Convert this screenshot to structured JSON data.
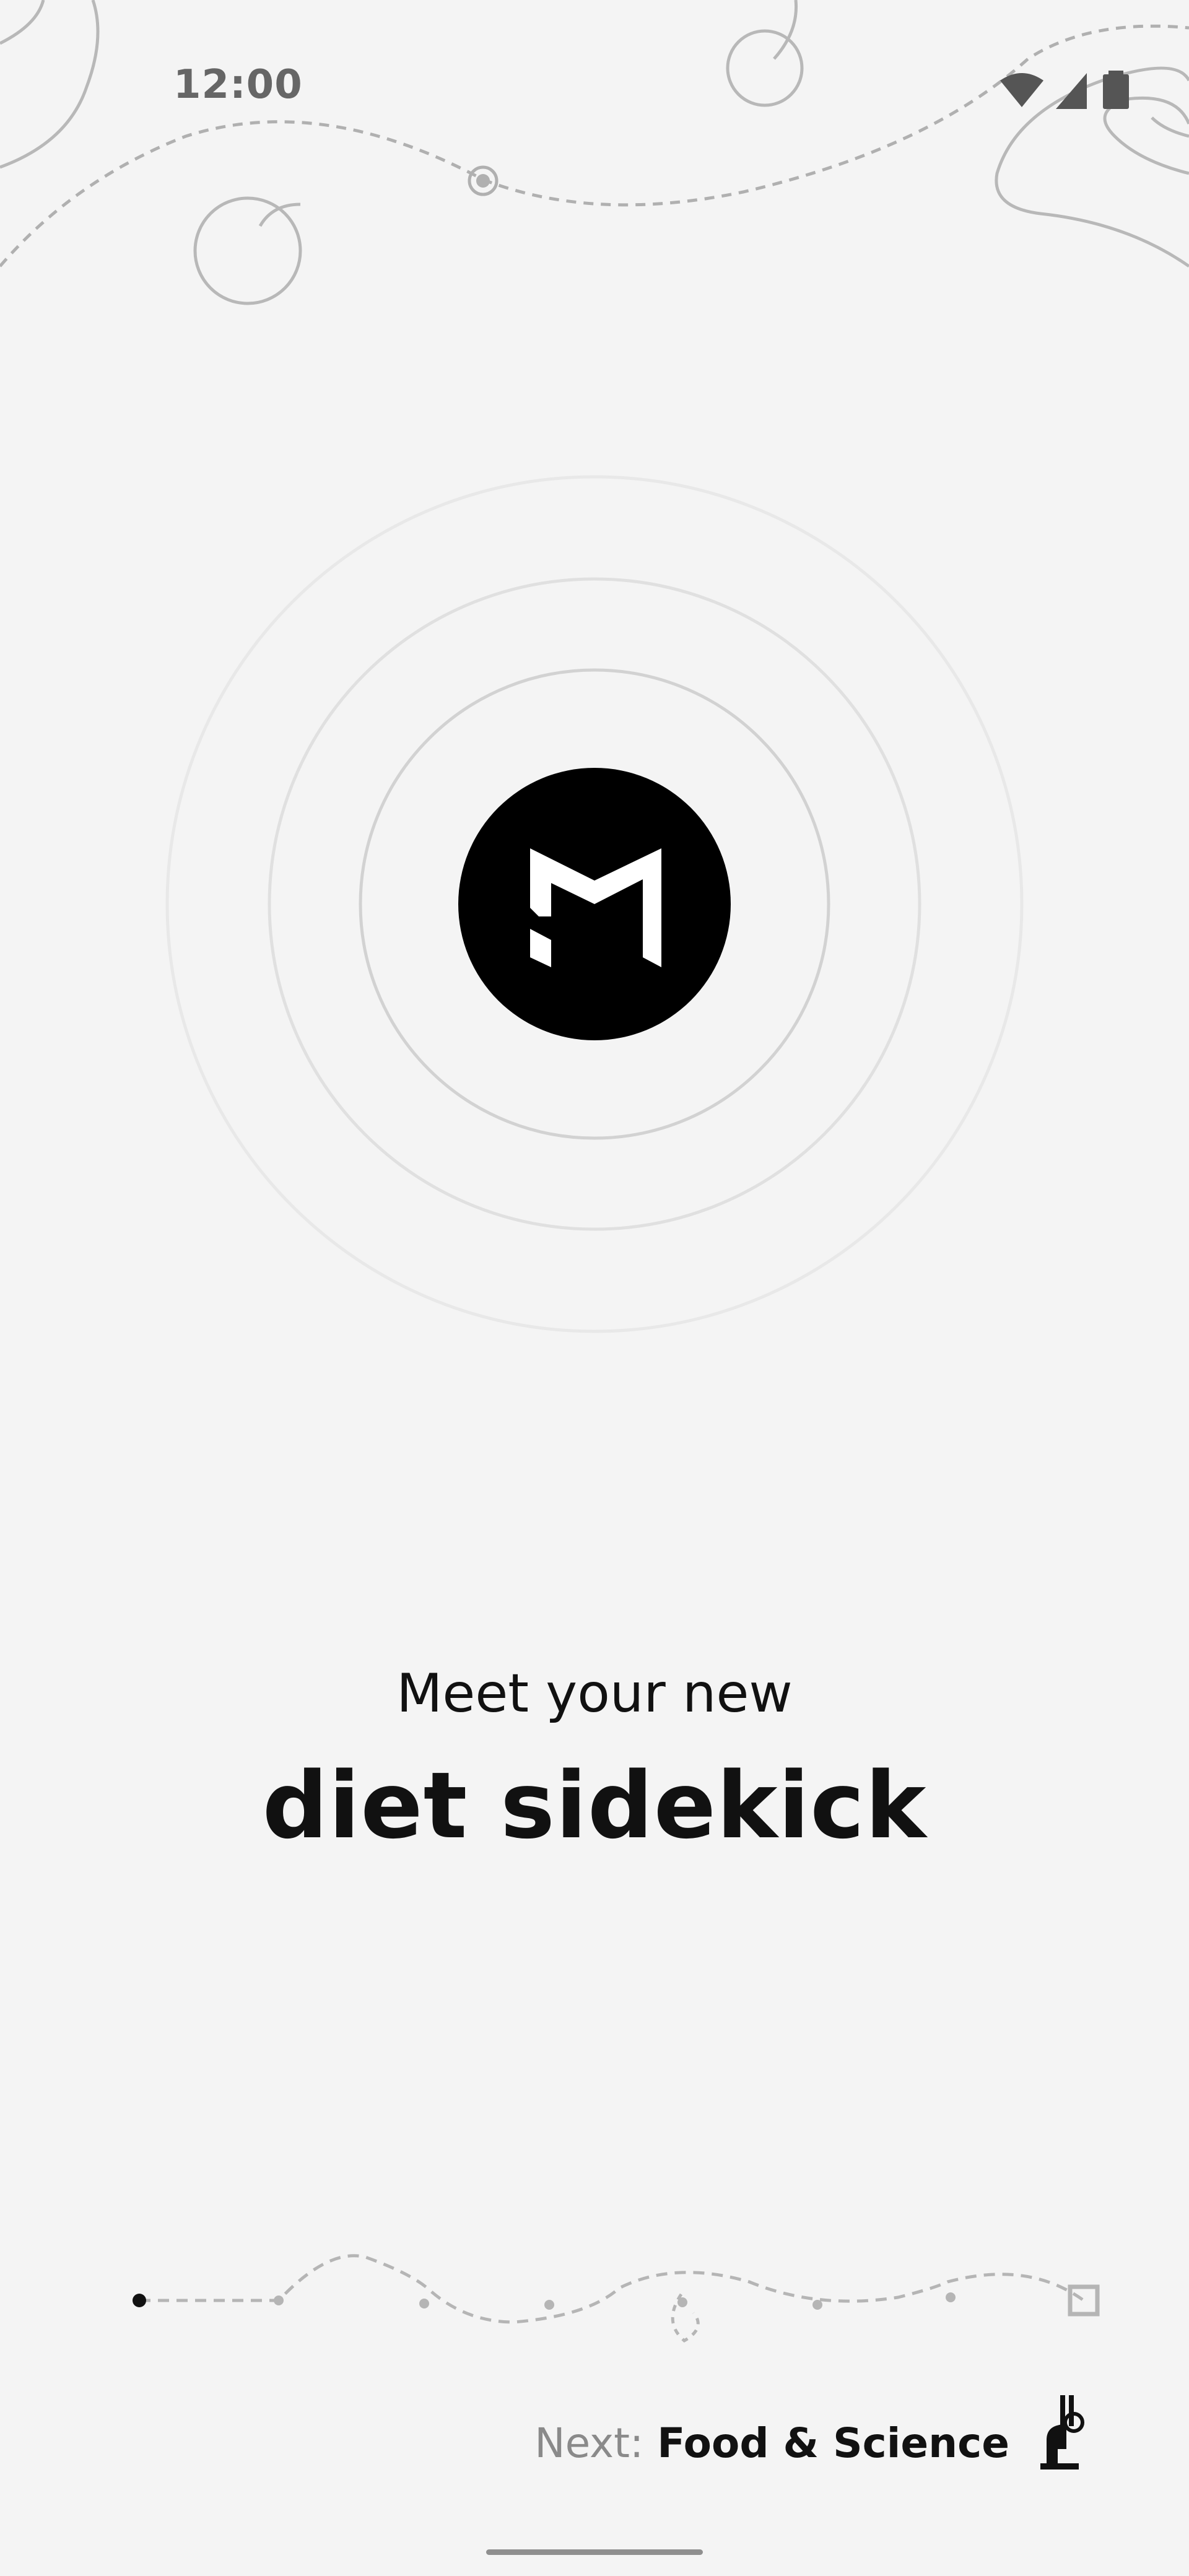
{
  "status_bar": {
    "time": "12:00",
    "icons": [
      "wifi-icon",
      "cellular-signal-icon",
      "battery-icon"
    ]
  },
  "logo": {
    "icon": "m-logo-icon",
    "accent": "#000000"
  },
  "headline": {
    "line1": "Meet your new",
    "line2": "diet sidekick"
  },
  "progress": {
    "total_steps": 8,
    "current_step": 1
  },
  "next": {
    "label": "Next:",
    "title": "Food & Science",
    "icon": "microscope-icon"
  },
  "colors": {
    "background": "#f4f4f4",
    "text": "#111111",
    "muted": "#8a8a8a"
  }
}
